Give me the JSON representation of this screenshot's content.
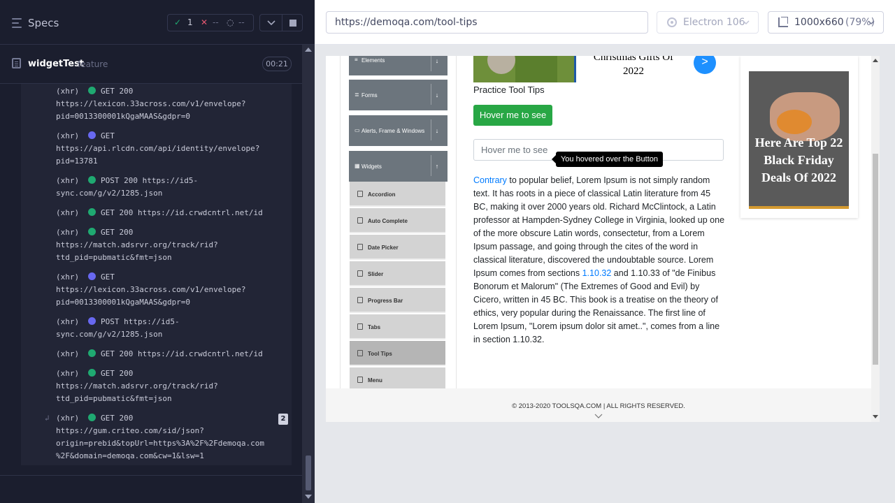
{
  "runner": {
    "specs_label": "Specs",
    "stats": {
      "passed": "1",
      "failed": "--",
      "pending": "--"
    },
    "spec": {
      "name": "widgetTest",
      "ext": "feature",
      "time": "00:21"
    },
    "log": [
      {
        "kind": "(xhr)",
        "status": "ok",
        "text": "GET 200\nhttps://lexicon.33across.com/v1/envelope?\npid=0013300001kQgaMAAS&gdpr=0"
      },
      {
        "kind": "(xhr)",
        "status": "pend",
        "text": "GET\nhttps://api.rlcdn.com/api/identity/envelope?\npid=13781"
      },
      {
        "kind": "(xhr)",
        "status": "ok",
        "text": "POST 200 https://id5-\nsync.com/g/v2/1285.json"
      },
      {
        "kind": "(xhr)",
        "status": "ok",
        "text": "GET 200 https://id.crwdcntrl.net/id"
      },
      {
        "kind": "(xhr)",
        "status": "ok",
        "text": "GET 200\nhttps://match.adsrvr.org/track/rid?\nttd_pid=pubmatic&fmt=json"
      },
      {
        "kind": "(xhr)",
        "status": "pend",
        "text": "GET\nhttps://lexicon.33across.com/v1/envelope?\npid=0013300001kQgaMAAS&gdpr=0"
      },
      {
        "kind": "(xhr)",
        "status": "pend",
        "text": "POST https://id5-\nsync.com/g/v2/1285.json"
      },
      {
        "kind": "(xhr)",
        "status": "ok",
        "text": "GET 200 https://id.crwdcntrl.net/id"
      },
      {
        "kind": "(xhr)",
        "status": "ok",
        "text": "GET 200\nhttps://match.adsrvr.org/track/rid?\nttd_pid=pubmatic&fmt=json"
      },
      {
        "kind": "(xhr)",
        "status": "ok",
        "text": "GET 200\nhttps://gum.criteo.com/sid/json?\norigin=prebid&topUrl=https%3A%2F%2Fdemoqa.com\n%2F&domain=demoqa.com&cw=1&lsw=1",
        "count": "2"
      }
    ]
  },
  "aut": {
    "url": "https://demoqa.com/tool-tips",
    "browser": "Electron 106",
    "viewport": "1000x660",
    "scale": "(79%)"
  },
  "page": {
    "nav_groups": [
      {
        "icon": "≡",
        "label": "Elements",
        "toggle": "↓"
      },
      {
        "icon": "≣",
        "label": "Forms",
        "toggle": "↓"
      },
      {
        "icon": "▭",
        "label": "Alerts, Frame & Windows",
        "toggle": "↓"
      },
      {
        "icon": "▦",
        "label": "Widgets",
        "toggle": "↑"
      }
    ],
    "widget_items": [
      "Accordion",
      "Auto Complete",
      "Date Picker",
      "Slider",
      "Progress Bar",
      "Tabs",
      "Tool Tips",
      "Menu"
    ],
    "ad_title": "Christmas Gifts Of 2022",
    "ad_next": ">",
    "practice_title": "Practice Tool Tips",
    "hover_button": "Hover me to see",
    "hover_input_placeholder": "Hover me to see",
    "tooltip": "You hovered over the Button",
    "para_link1": "Contrary",
    "para_part1": " to popular belief, Lorem Ipsum is not simply random text. It has roots in a piece of classical Latin literature from 45 BC, making it over 2000 years old. Richard McClintock, a Latin professor at Hampden-Sydney College in Virginia, looked up one of the more obscure Latin words, consectetur, from a Lorem Ipsum passage, and going through the cites of the word in classical literature, discovered the undoubtable source. Lorem Ipsum comes from sections ",
    "para_link2": "1.10.32",
    "para_part2": " and 1.10.33 of \"de Finibus Bonorum et Malorum\" (The Extremes of Good and Evil) by Cicero, written in 45 BC. This book is a treatise on the theory of ethics, very popular during the Renaissance. The first line of Lorem Ipsum, \"Lorem ipsum dolor sit amet..\", comes from a line in section 1.10.32.",
    "side_ad_text": "Here Are Top 22 Black Friday Deals Of 2022",
    "footer": "© 2013-2020 TOOLSQA.COM | ALL RIGHTS RESERVED."
  }
}
